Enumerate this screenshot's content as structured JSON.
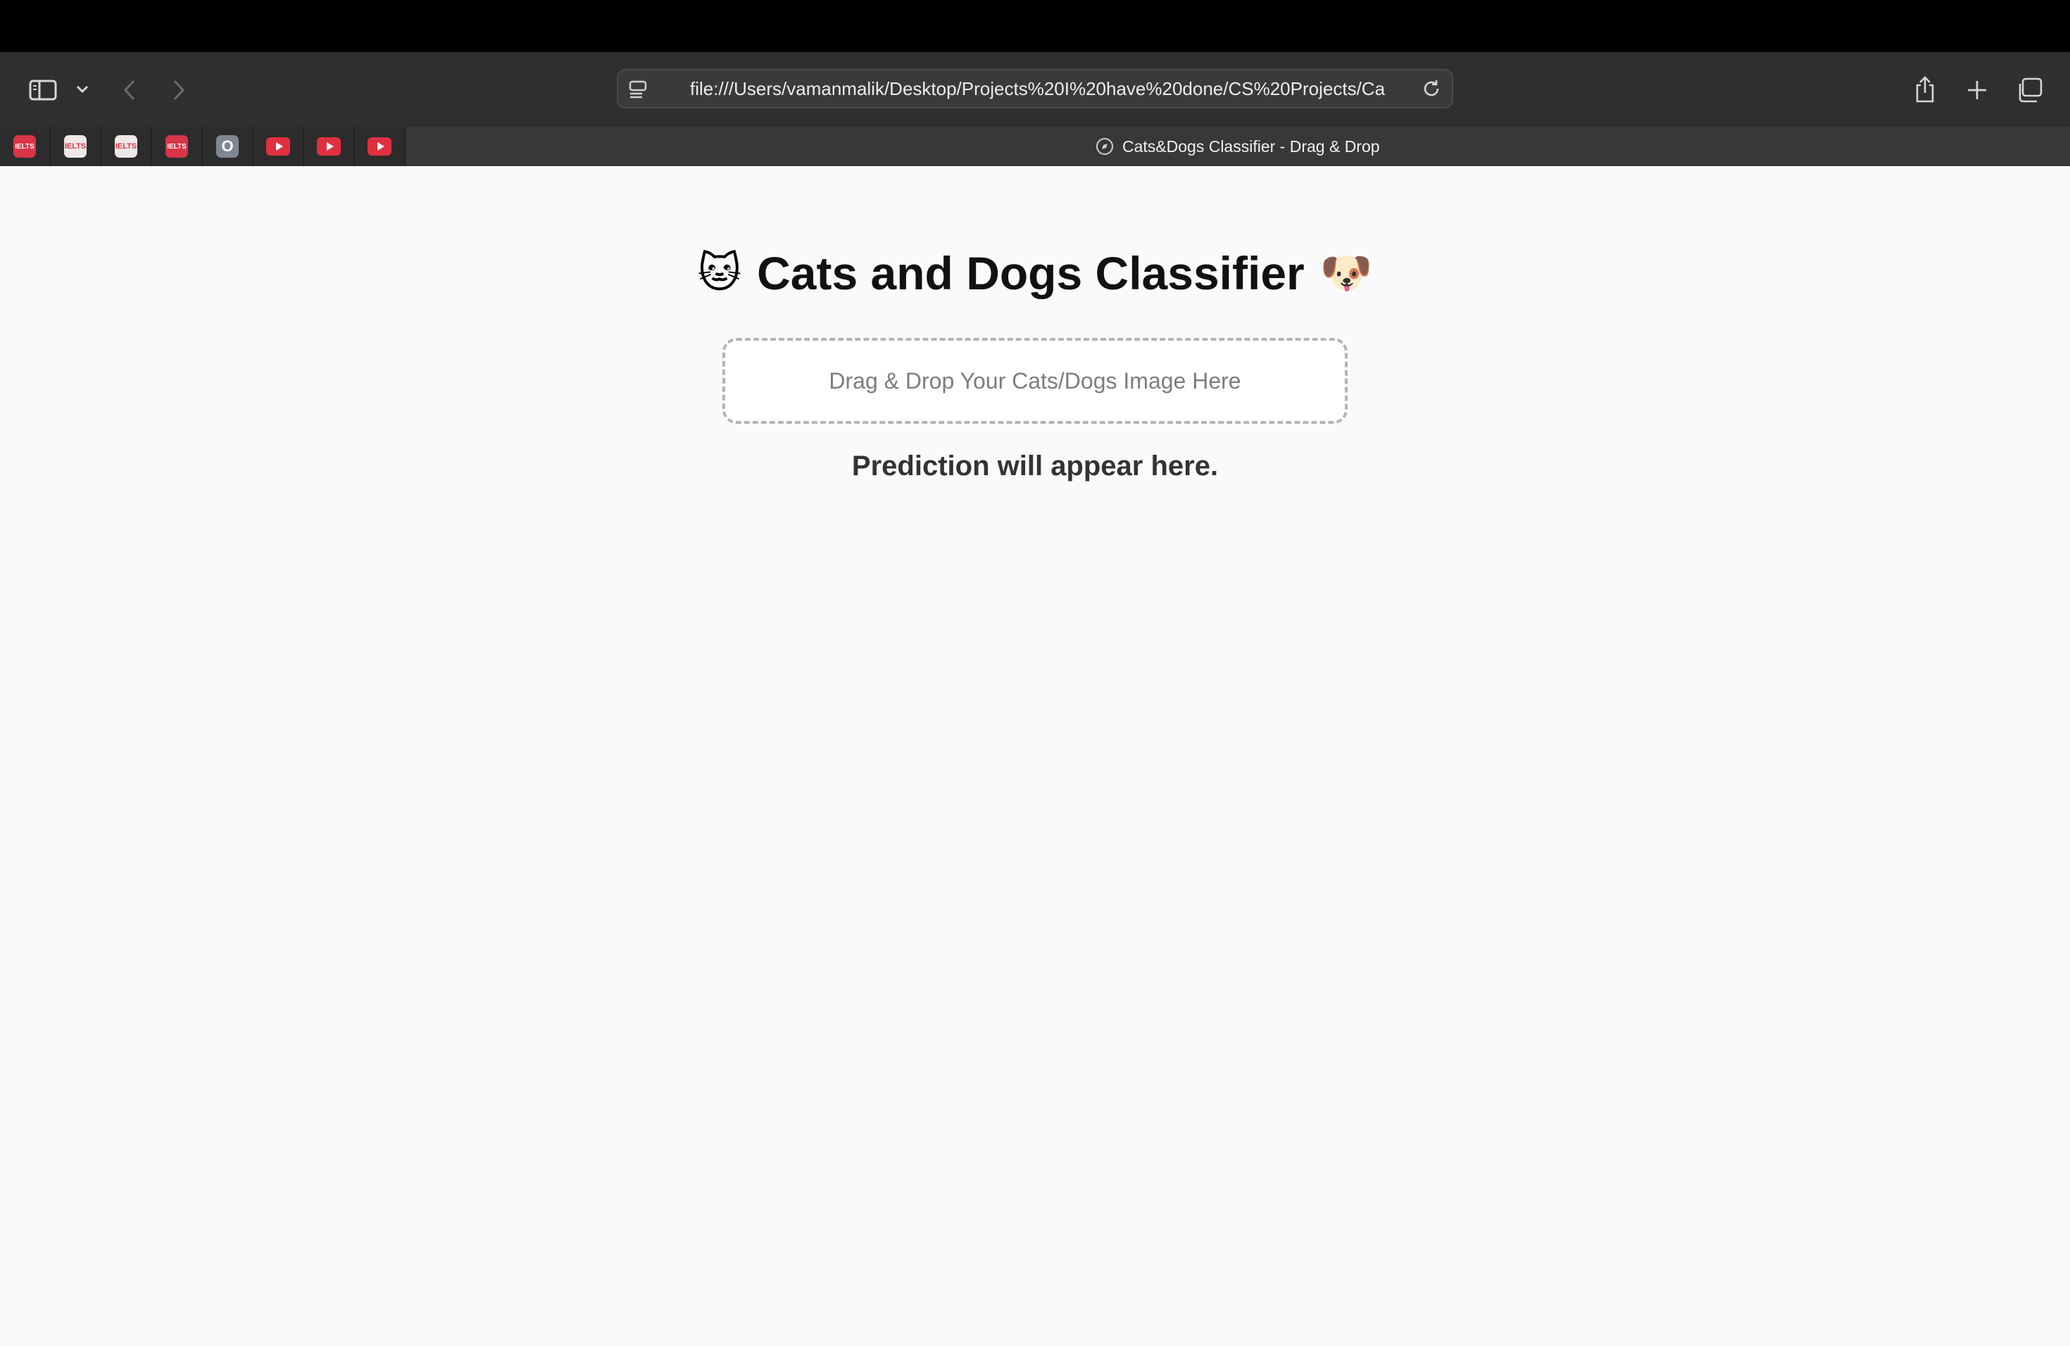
{
  "browser": {
    "url": "file:///Users/vamanmalik/Desktop/Projects%20I%20have%20done/CS%20Projects/Ca",
    "active_tab_title": "Cats&Dogs Classifier - Drag & Drop",
    "toolbar_icons": [
      "sidebar-icon",
      "chevron-down-icon",
      "back-icon",
      "forward-icon",
      "share-icon",
      "plus-icon",
      "tabs-overview-icon",
      "reload-icon"
    ],
    "pinned_tabs": [
      {
        "icon": "ielts-icon",
        "text": "IELTS"
      },
      {
        "icon": "ielts-icon",
        "text": "IELTS"
      },
      {
        "icon": "ielts-icon",
        "text": "IELTS"
      },
      {
        "icon": "ielts-icon",
        "text": "IELTS"
      },
      {
        "icon": "o-icon",
        "text": "O"
      },
      {
        "icon": "youtube-icon",
        "text": ""
      },
      {
        "icon": "youtube-icon",
        "text": ""
      },
      {
        "icon": "youtube-icon",
        "text": ""
      }
    ]
  },
  "page": {
    "title_emoji_left": "🐱",
    "title": "Cats and Dogs Classifier",
    "title_emoji_right": "🐶",
    "dropzone_text": "Drag & Drop Your Cats/Dogs Image Here",
    "prediction_text": "Prediction will appear here."
  },
  "colors": {
    "toolbar_bg": "#2f2f2f",
    "page_bg": "#fafafa",
    "dropzone_border": "#b4b4b4",
    "favicon_red": "#d93447"
  }
}
